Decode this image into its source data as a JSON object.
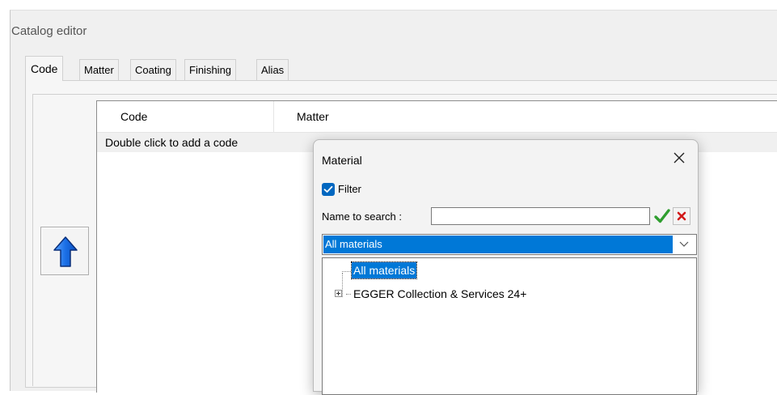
{
  "window": {
    "title": "Catalog editor"
  },
  "tabs": [
    {
      "label": "Code",
      "active": true
    },
    {
      "label": "Matter",
      "active": false
    },
    {
      "label": "Coating",
      "active": false
    },
    {
      "label": "Finishing",
      "active": false
    },
    {
      "label": "Alias",
      "active": false
    }
  ],
  "toolbar": {
    "move_up_icon": "arrow-up-icon",
    "accent": "#1565d8"
  },
  "grid": {
    "columns": [
      "Code",
      "Matter"
    ],
    "placeholder_row": "Double click to add a code"
  },
  "dialog": {
    "title": "Material",
    "close_icon": "close-icon",
    "filter": {
      "label": "Filter",
      "checked": true
    },
    "search": {
      "label": "Name to search :",
      "value": "",
      "placeholder": ""
    },
    "ok_icon": "checkmark-icon",
    "cancel_icon": "red-x-icon",
    "combo": {
      "selected": "All materials"
    },
    "tree": [
      {
        "label": "All materials",
        "selected": true,
        "expandable": false
      },
      {
        "label": "EGGER Collection & Services 24+",
        "selected": false,
        "expandable": true
      }
    ],
    "selection_color": "#0078d7"
  }
}
